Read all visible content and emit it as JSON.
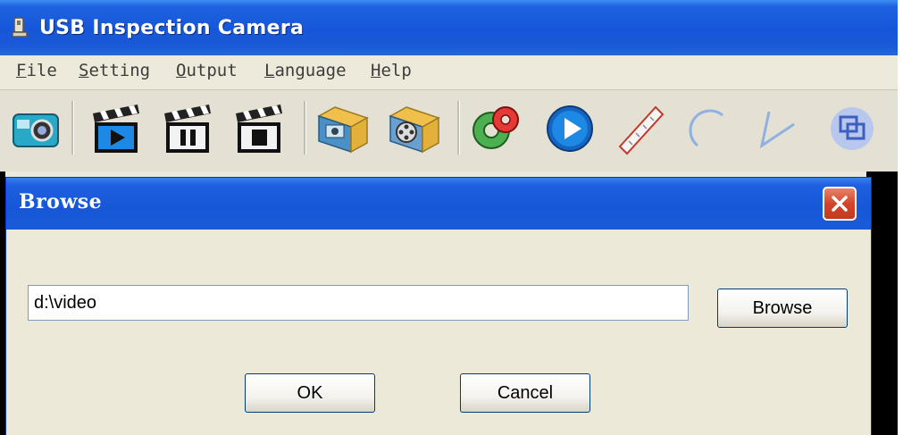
{
  "window": {
    "title": "USB Inspection Camera",
    "icon": "camera-app-icon"
  },
  "menu": {
    "items": [
      "File",
      "Setting",
      "Output",
      "Language",
      "Help"
    ]
  },
  "toolbar": {
    "buttons": [
      {
        "name": "snapshot-camera-icon"
      },
      {
        "name": "record-play-clapper-icon"
      },
      {
        "name": "record-pause-clapper-icon"
      },
      {
        "name": "record-stop-clapper-icon"
      },
      {
        "name": "photo-folder-icon"
      },
      {
        "name": "video-folder-icon"
      },
      {
        "name": "settings-gear-icon"
      },
      {
        "name": "play-circle-icon"
      },
      {
        "name": "ruler-measure-icon"
      },
      {
        "name": "arc-measure-icon"
      },
      {
        "name": "angle-measure-icon"
      },
      {
        "name": "overlay-window-icon"
      }
    ]
  },
  "dialog": {
    "title": "Browse",
    "path_value": "d:\\video",
    "browse_label": "Browse",
    "ok_label": "OK",
    "cancel_label": "Cancel"
  },
  "colors": {
    "titlebar_blue": "#1656d9",
    "close_red": "#d4452a",
    "window_bg": "#ece9d8"
  }
}
